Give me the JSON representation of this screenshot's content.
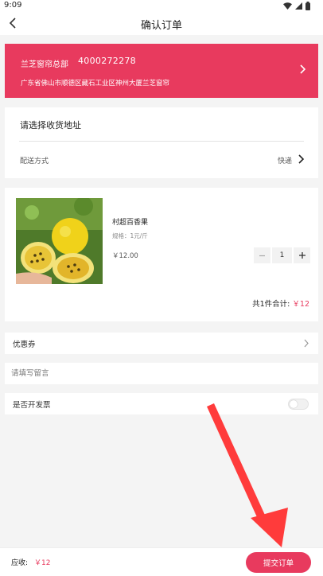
{
  "status_bar": {
    "time": "9:09"
  },
  "nav": {
    "title": "确认订单"
  },
  "store": {
    "name": "兰芝窗帘总部",
    "phone": "4000272278",
    "address": "广东省佛山市顺德区藏石工业区神州大厦兰芝窗帘"
  },
  "address_section": {
    "select_label": "请选择收货地址",
    "delivery_label": "配送方式",
    "delivery_value": "快递"
  },
  "product": {
    "name": "村超百香果",
    "spec": "规格：1元/斤",
    "price": "￥12.00",
    "quantity": "1",
    "summary_label": "共1件合计:",
    "summary_total": "￥12"
  },
  "options": {
    "coupon_label": "优惠券",
    "message_placeholder": "请填写留言",
    "invoice_label": "是否开发票",
    "invoice_enabled": false
  },
  "footer": {
    "payable_label": "应收:",
    "payable_value": "￥12",
    "submit_label": "提交订单"
  },
  "colors": {
    "accent": "#e83a5e",
    "background": "#f4f4f4",
    "annotation_arrow": "#ff3b3b"
  },
  "icons": [
    "wifi-icon",
    "signal-icon",
    "battery-icon",
    "back-arrow-icon",
    "chevron-right-icon",
    "minus-icon",
    "plus-icon"
  ]
}
